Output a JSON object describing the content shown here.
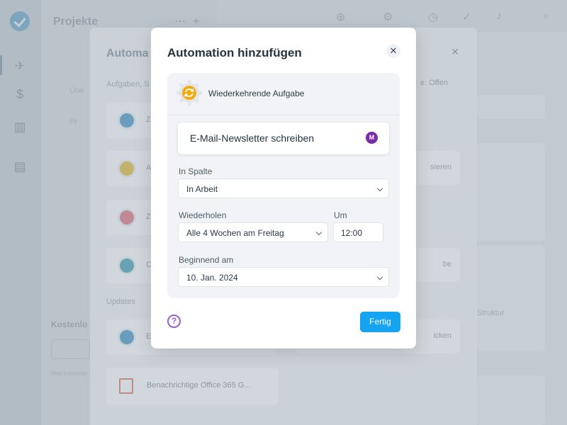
{
  "background": {
    "sidebar": {
      "icons": [
        "app-logo-icon",
        "rocket-icon",
        "dollar-icon",
        "chart-icon",
        "document-icon"
      ]
    },
    "projects": {
      "title": "Projekte",
      "items": [
        "Übe",
        "Pr"
      ],
      "trial_title": "Kostenlo Testversi",
      "trial_note": "Ihre kostenlo 2024"
    },
    "drawer": {
      "title": "Automa",
      "section_tasks": "Aufgaben, S",
      "section_updates": "Updates",
      "filter": "e: Offen",
      "cards": [
        {
          "label": "Z",
          "color": "blue"
        },
        {
          "label": "A",
          "color": "yellow"
        },
        {
          "label": "Z",
          "color": "red"
        },
        {
          "label": "C",
          "color": "teal"
        },
        {
          "label": "E",
          "color": "blue"
        }
      ],
      "right_cards": [
        "sieren",
        "be",
        "icken"
      ],
      "office_card": "Benachrichtige Office 365 G..."
    },
    "board": {
      "struktur": "Struktur"
    }
  },
  "modal": {
    "title": "Automation hinzufügen",
    "close_icon": "close-icon",
    "automation_type": "Wiederkehrende Aufgabe",
    "task_name": "E-Mail-Newsletter schreiben",
    "assignee_initial": "M",
    "column_label": "In Spalte",
    "column_value": "In Arbeit",
    "repeat_label": "Wiederholen",
    "repeat_value": "Alle 4 Wochen am Freitag",
    "time_label": "Um",
    "time_value": "12:00",
    "start_label": "Beginnend am",
    "start_value": "10. Jan. 2024",
    "help_label": "?",
    "done_label": "Fertig"
  },
  "colors": {
    "accent": "#14a4f2",
    "help": "#9b5fd0",
    "avatar": "#7b2aa6",
    "gear_icon": "#f4a90c"
  }
}
